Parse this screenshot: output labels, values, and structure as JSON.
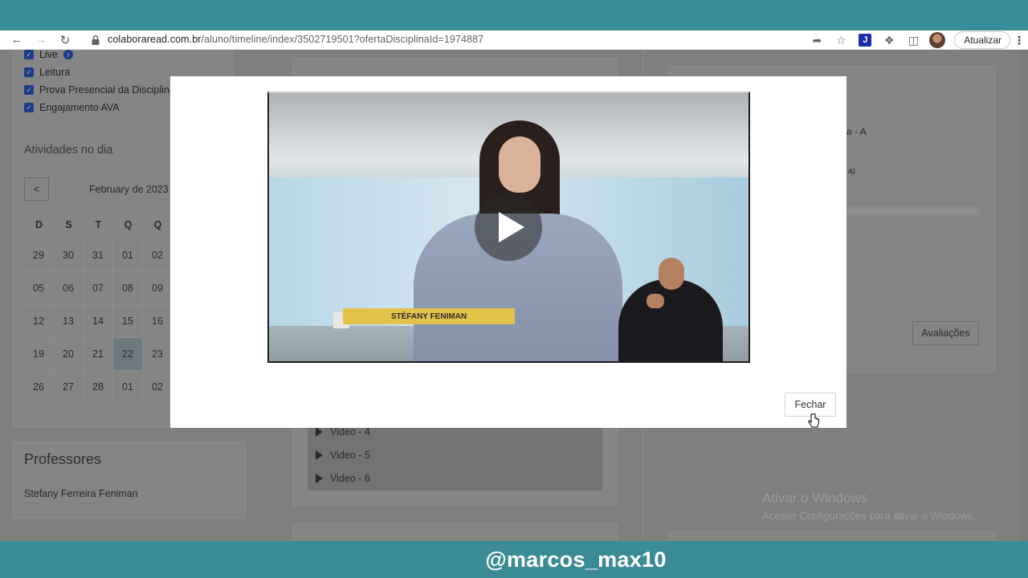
{
  "browser": {
    "url_host": "colaboraread.com.br",
    "url_path": "/aluno/timeline/index/3502719501?ofertaDisciplinaId=1974887",
    "update_label": "Atualizar",
    "extension_label": "J"
  },
  "filters": [
    {
      "label": "Live",
      "checked": true,
      "info": "i"
    },
    {
      "label": "Leitura",
      "checked": true
    },
    {
      "label": "Prova Presencial da Disciplina",
      "checked": true
    },
    {
      "label": "Engajamento AVA",
      "checked": true
    }
  ],
  "calendar": {
    "title": "Atividades no dia",
    "month_label": "February de 2023",
    "prev_label": "<",
    "weekdays": [
      "D",
      "S",
      "T",
      "Q",
      "Q"
    ],
    "weeks": [
      [
        "29",
        "30",
        "31",
        "01",
        "02"
      ],
      [
        "05",
        "06",
        "07",
        "08",
        "09"
      ],
      [
        "12",
        "13",
        "14",
        "15",
        "16"
      ],
      [
        "19",
        "20",
        "21",
        "22",
        "23"
      ],
      [
        "26",
        "27",
        "28",
        "01",
        "02"
      ]
    ],
    "today": "22"
  },
  "professors": {
    "title": "Professores",
    "name": "Stefany Ferreira Feniman"
  },
  "videos": [
    "Video - 4",
    "Video - 5",
    "Video - 6"
  ],
  "right_panel": {
    "fragment_1": "a - A",
    "fragment_2": "a)",
    "button": "Avaliações"
  },
  "windows_watermark": {
    "title": "Ativar o Windows",
    "subtitle": "Acesse Configurações para ativar o Windows."
  },
  "modal": {
    "lower_third": "STÉFANY FENIMAN",
    "close_label": "Fechar"
  },
  "overlay": {
    "handle": "@marcos_max10"
  }
}
